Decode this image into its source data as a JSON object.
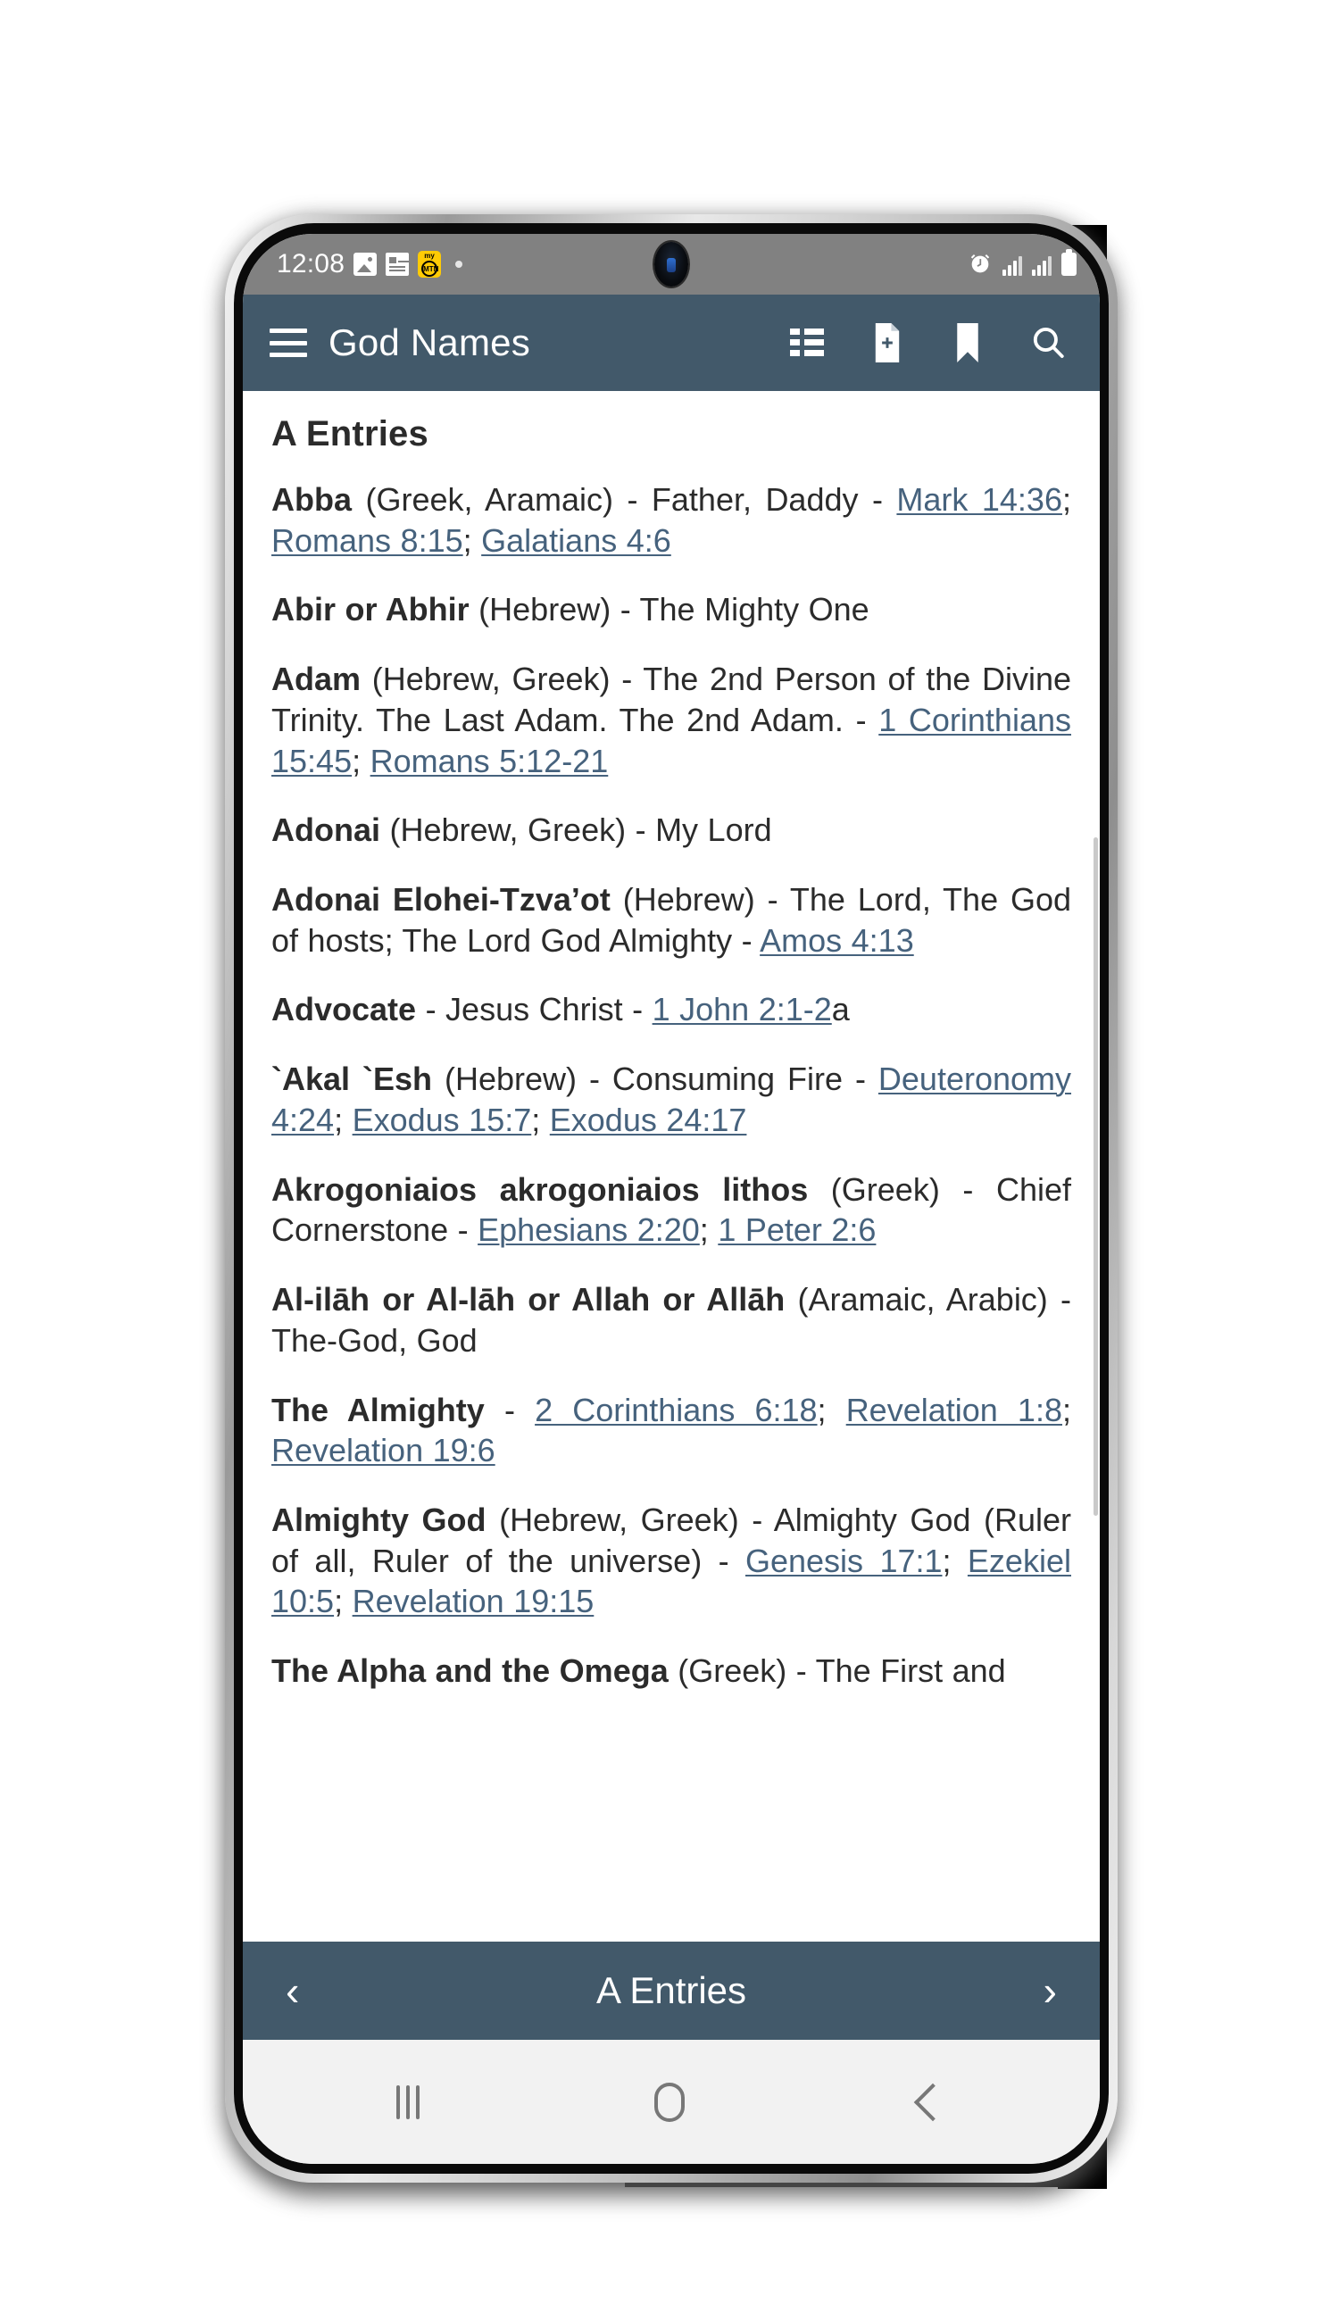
{
  "statusbar": {
    "time": "12:08",
    "icons_left": [
      "image-icon",
      "news-icon",
      "mtn-icon",
      "dot-indicator"
    ],
    "mtn_top": "my",
    "mtn_label": "MTN",
    "icons_right": [
      "alarm-icon",
      "signal-icon",
      "signal-icon",
      "battery-icon"
    ]
  },
  "appbar": {
    "menu_icon": "hamburger-menu-icon",
    "title": "God Names",
    "actions": [
      {
        "name": "list-view-icon"
      },
      {
        "name": "note-add-icon"
      },
      {
        "name": "bookmark-icon"
      },
      {
        "name": "search-icon"
      }
    ]
  },
  "content": {
    "heading": "A Entries",
    "entries": [
      {
        "name": "Abba",
        "body": " (Greek, Aramaic) - Father, Daddy - ",
        "refs": [
          "Mark 14:36",
          "Romans 8:15",
          "Galatians 4:6"
        ],
        "ref_sep": "; ",
        "tail": ""
      },
      {
        "name": "Abir or Abhir",
        "body": " (Hebrew) - The Mighty One",
        "refs": [],
        "ref_sep": "; ",
        "tail": ""
      },
      {
        "name": "Adam",
        "body": " (Hebrew, Greek) - The 2nd Person of the Divine Trinity. The Last Adam. The 2nd Adam. - ",
        "refs": [
          "1 Corinthians 15:45",
          "Romans 5:12-21"
        ],
        "ref_sep": "; ",
        "tail": ""
      },
      {
        "name": "Adonai",
        "body": " (Hebrew, Greek) - My Lord",
        "refs": [],
        "ref_sep": "; ",
        "tail": ""
      },
      {
        "name": "Adonai Elohei-Tzva’ot",
        "body": " (Hebrew) - The Lord, The God of hosts; The Lord God Almighty - ",
        "refs": [
          "Amos 4:13"
        ],
        "ref_sep": "; ",
        "tail": ""
      },
      {
        "name": "Advocate",
        "body": " - Jesus Christ - ",
        "refs": [
          "1 John 2:1-2"
        ],
        "ref_sep": "; ",
        "tail": "a"
      },
      {
        "name": "`Akal `Esh",
        "body": " (Hebrew) - Consuming Fire - ",
        "refs": [
          "Deuteronomy 4:24",
          "Exodus 15:7",
          "Exodus 24:17"
        ],
        "ref_sep": "; ",
        "tail": ""
      },
      {
        "name": "Akrogoniaios akrogoniaios lithos",
        "body": " (Greek) - Chief Cornerstone - ",
        "refs": [
          "Ephesians 2:20",
          "1 Peter 2:6"
        ],
        "ref_sep": "; ",
        "tail": ""
      },
      {
        "name": "Al-ilāh or Al-lāh or Allah or Allāh",
        "body": " (Aramaic, Arabic) - The-God, God",
        "refs": [],
        "ref_sep": "; ",
        "tail": ""
      },
      {
        "name": "The Almighty",
        "body": " - ",
        "refs": [
          "2 Corinthians 6:18",
          "Revelation 1:8",
          "Revelation 19:6"
        ],
        "ref_sep": "; ",
        "tail": ""
      },
      {
        "name": "Almighty God",
        "body": " (Hebrew, Greek) - Almighty God (Ruler of all, Ruler of the universe) - ",
        "refs": [
          "Genesis 17:1",
          "Ezekiel 10:5",
          "Revelation 19:15"
        ],
        "ref_sep": "; ",
        "tail": ""
      },
      {
        "name": "The Alpha and the Omega",
        "body": " (Greek) - The First and",
        "refs": [],
        "ref_sep": "; ",
        "tail": ""
      }
    ]
  },
  "bottombar": {
    "prev": "‹",
    "title": "A Entries",
    "next": "›"
  },
  "androidnav": {
    "recents": "recents-icon",
    "home": "home-icon",
    "back": "back-icon"
  },
  "colors": {
    "appbar": "#42596a",
    "statusbar": "#818181",
    "link": "#46627d",
    "text": "#2b2b2b",
    "mtn_yellow": "#ffcb05"
  }
}
